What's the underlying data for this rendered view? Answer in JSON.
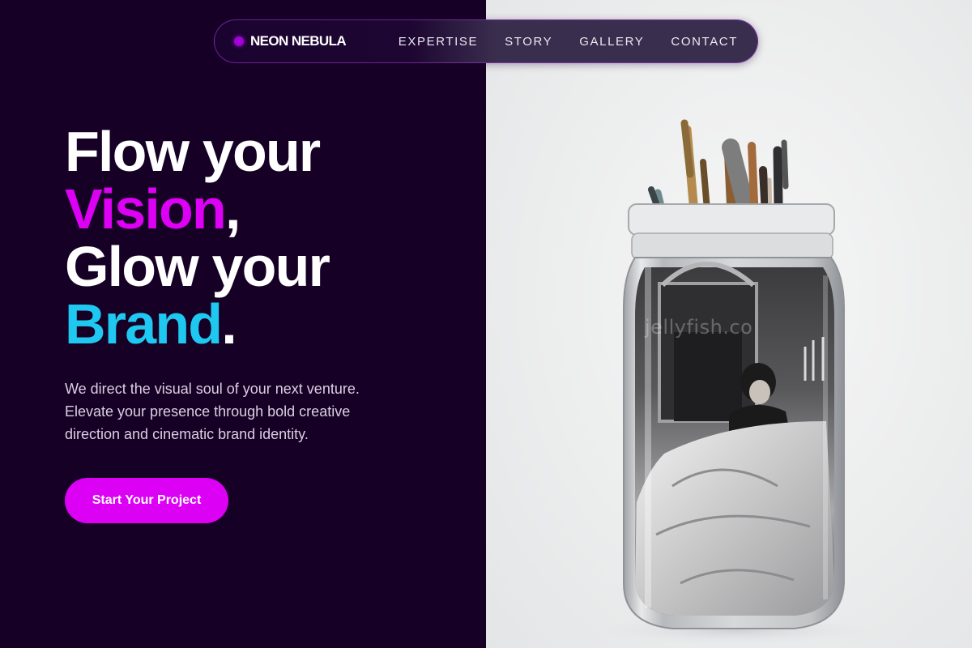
{
  "brand": {
    "name": "NEON NEBULA",
    "icon": "dot-icon",
    "dot_color": "#a100d8"
  },
  "nav": {
    "links": [
      "EXPERTISE",
      "STORY",
      "GALLERY",
      "CONTACT"
    ]
  },
  "hero": {
    "line1": "Flow your",
    "line2_accent": "Vision",
    "line2_rest": ",",
    "line3": "Glow your",
    "line4_accent": "Brand",
    "line4_rest": ".",
    "subtitle_lines": [
      "We direct the visual soul of your next venture.",
      "Elevate your presence through bold creative",
      "direction and cinematic brand identity."
    ],
    "cta_label": "Start Your Project"
  },
  "image": {
    "watermark": "jellyfish.co"
  },
  "colors": {
    "background_dark": "#170025",
    "accent_magenta": "#dc00f5",
    "accent_cyan": "#1fc8f0",
    "text_white": "#ffffff",
    "photo_background": "#eceded"
  }
}
